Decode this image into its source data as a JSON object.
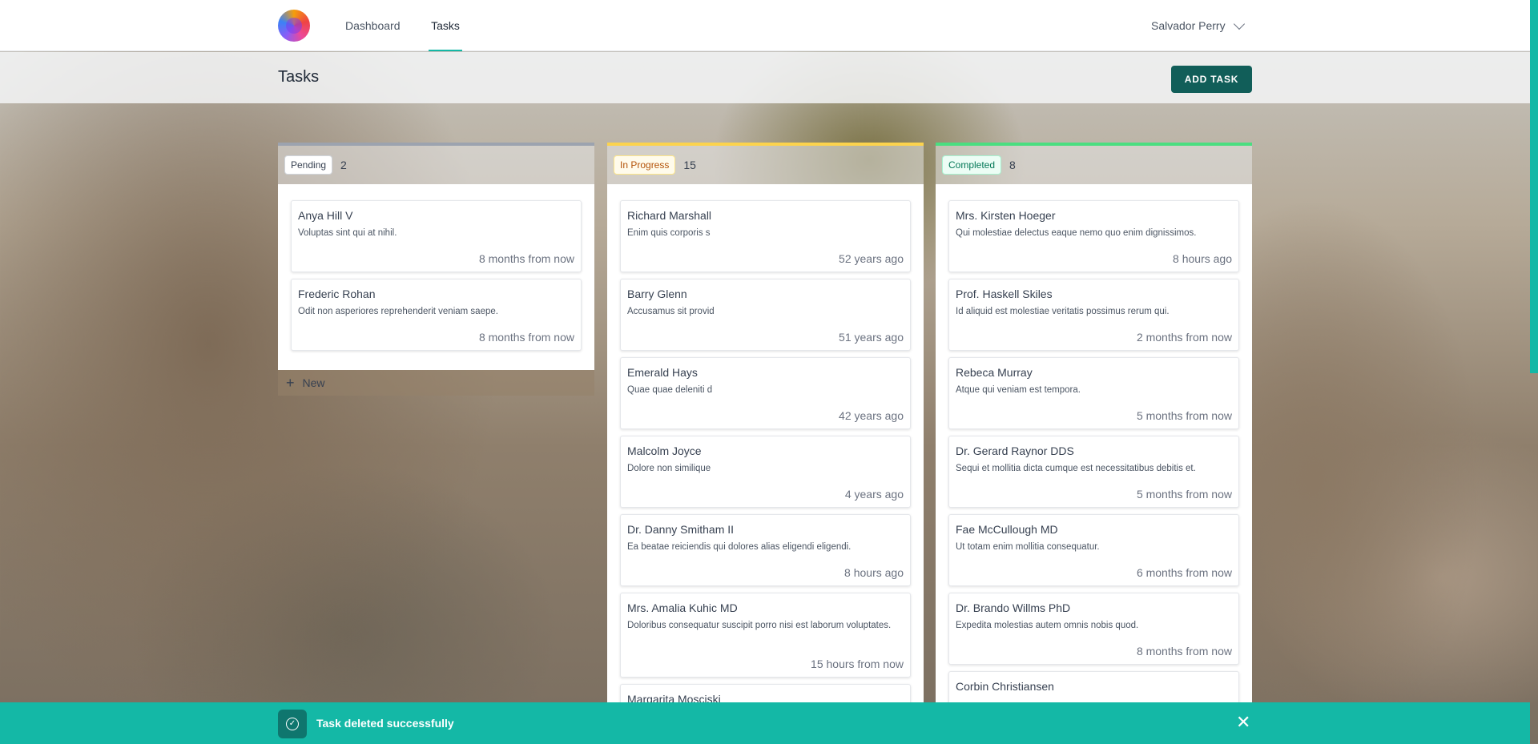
{
  "nav": {
    "links": [
      "Dashboard",
      "Tasks"
    ],
    "active": "Tasks",
    "user_name": "Salvador Perry"
  },
  "header": {
    "title": "Tasks",
    "add_task_label": "ADD TASK"
  },
  "columns": {
    "pending": {
      "label": "Pending",
      "count": "2",
      "color": "#9ca3af",
      "tasks": [
        {
          "name": "Anya Hill V",
          "desc": "Voluptas sint qui at nihil.",
          "date": "8 months from now"
        },
        {
          "name": "Frederic Rohan",
          "desc": "Odit non asperiores reprehenderit veniam saepe.",
          "date": "8 months from now"
        }
      ],
      "new_label": "New"
    },
    "in_progress": {
      "label": "In Progress",
      "count": "15",
      "color": "#fcd34d",
      "tasks": [
        {
          "name": "Richard Marshall",
          "desc": "Enim quis corporis s",
          "date": "52 years ago"
        },
        {
          "name": "Barry Glenn",
          "desc": "Accusamus sit provid",
          "date": "51 years ago"
        },
        {
          "name": "Emerald Hays",
          "desc": "Quae quae deleniti d",
          "date": "42 years ago"
        },
        {
          "name": "Malcolm Joyce",
          "desc": "Dolore non similique",
          "date": "4 years ago"
        },
        {
          "name": "Dr. Danny Smitham II",
          "desc": "Ea beatae reiciendis qui dolores alias eligendi eligendi.",
          "date": "8 hours ago"
        },
        {
          "name": "Mrs. Amalia Kuhic MD",
          "desc": "Doloribus consequatur suscipit porro nisi est laborum voluptates.",
          "date": "15 hours from now"
        },
        {
          "name": "Margarita Mosciski",
          "desc": "",
          "date": ""
        }
      ]
    },
    "completed": {
      "label": "Completed",
      "count": "8",
      "color": "#4ade80",
      "tasks": [
        {
          "name": "Mrs. Kirsten Hoeger",
          "desc": "Qui molestiae delectus eaque nemo quo enim dignissimos.",
          "date": "8 hours ago"
        },
        {
          "name": "Prof. Haskell Skiles",
          "desc": "Id aliquid est molestiae veritatis possimus rerum qui.",
          "date": "2 months from now"
        },
        {
          "name": "Rebeca Murray",
          "desc": "Atque qui veniam est tempora.",
          "date": "5 months from now"
        },
        {
          "name": "Dr. Gerard Raynor DDS",
          "desc": "Sequi et mollitia dicta cumque est necessitatibus debitis et.",
          "date": "5 months from now"
        },
        {
          "name": "Fae McCullough MD",
          "desc": "Ut totam enim mollitia consequatur.",
          "date": "6 months from now"
        },
        {
          "name": "Dr. Brando Willms PhD",
          "desc": "Expedita molestias autem omnis nobis quod.",
          "date": "8 months from now"
        },
        {
          "name": "Corbin Christiansen",
          "desc": "",
          "date": ""
        }
      ]
    }
  },
  "toast": {
    "message": "Task deleted successfully",
    "icon": "check-circle-icon",
    "close_icon": "close-icon"
  },
  "colors": {
    "accent": "#14b8a6",
    "button": "#115e59"
  }
}
